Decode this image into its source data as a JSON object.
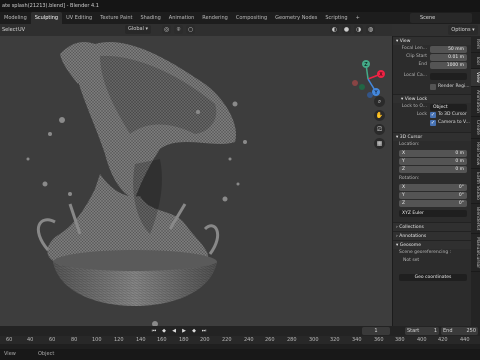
{
  "window": {
    "title": "ate splash(21213).blend] - Blender 4.1"
  },
  "menubar": {
    "workspaces": [
      "Modeling",
      "Sculpting",
      "UV Editing",
      "Texture Paint",
      "Shading",
      "Animation",
      "Rendering",
      "Compositing",
      "Geometry Nodes",
      "Scripting",
      "+"
    ],
    "active_workspace": "Sculpting",
    "scene": "Scene"
  },
  "viewport_header": {
    "select_label": "Select",
    "add_label": "Add",
    "object_label": "Object",
    "uv_label": "UV",
    "orientation": "Global",
    "options_label": "Options"
  },
  "gizmo": {
    "x": "X",
    "y": "Y",
    "z": "Z"
  },
  "sidebar_tabs": [
    "Item",
    "Tool",
    "View",
    "Animation",
    "Create",
    "Real Snow",
    "Earth Studio",
    "BlenderKit",
    "ManualCursor"
  ],
  "active_tab": "View",
  "view_panel": {
    "title": "View",
    "focal_label": "Focal Len...",
    "focal_value": "50 mm",
    "clip_label": "Clip Start",
    "clip_value": "0.01 m",
    "end_label": "End",
    "end_value": "1000 m",
    "local_camera_label": "Local Ca...",
    "render_region_label": "Render Regi..."
  },
  "view_lock_panel": {
    "title": "View Lock",
    "lock_to_label": "Lock to O...",
    "lock_to_value": "Object",
    "lock_label": "Lock",
    "to_3d_cursor_label": "To 3D Cursor",
    "camera_to_view_label": "Camera to V..."
  },
  "cursor_panel": {
    "title": "3D Cursor",
    "location_label": "Location:",
    "loc_x_label": "X",
    "loc_x_value": "0 m",
    "loc_y_label": "Y",
    "loc_y_value": "0 m",
    "loc_z_label": "Z",
    "loc_z_value": "0 m",
    "rotation_label": "Rotation:",
    "rot_x_label": "X",
    "rot_x_value": "0°",
    "rot_y_label": "Y",
    "rot_y_value": "0°",
    "rot_z_label": "Z",
    "rot_z_value": "0°",
    "rotation_mode": "XYZ Euler"
  },
  "collapsed_panels": [
    "Collections",
    "Annotations",
    "Geosome"
  ],
  "geosome_panel": {
    "georef_label": "Scene georeferencing :",
    "not_set_label": "Not set",
    "bbox_label": "Geo coordinates"
  },
  "timeline": {
    "playhead": "1",
    "start_label": "Start",
    "start_value": "1",
    "end_label": "End",
    "end_value": "250",
    "ruler_ticks": [
      "60",
      "40",
      "60",
      "80",
      "100",
      "120",
      "140",
      "160",
      "180",
      "200",
      "220",
      "240",
      "260",
      "280",
      "300",
      "320",
      "340",
      "360",
      "380",
      "400",
      "420",
      "440"
    ]
  },
  "statusbar": {
    "view_label": "View",
    "object_label": "Object"
  }
}
